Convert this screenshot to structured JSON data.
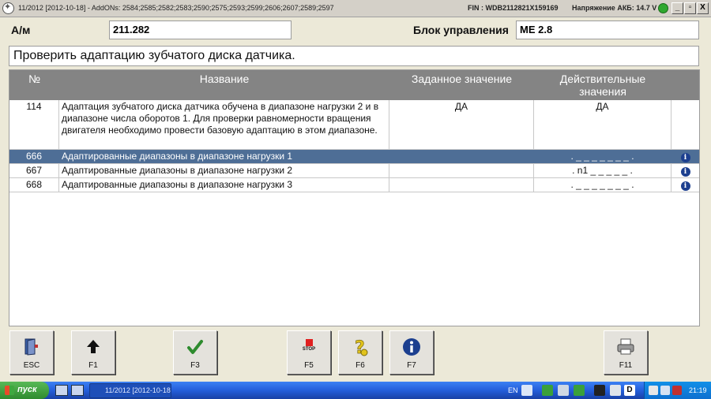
{
  "window": {
    "title": "11/2012 [2012-10-18] - AddONs: 2584;2585;2582;2583;2590;2575;2593;2599;2606;2607;2589;2597",
    "fin": "FIN : WDB2112821X159169",
    "battery": "Напряжение АКБ: 14.7 V",
    "controls": [
      "_",
      "▫",
      "X"
    ]
  },
  "header": {
    "vehicle_label": "А/м",
    "vehicle_value": "211.282",
    "ecu_label": "Блок управления",
    "ecu_value": "ME 2.8"
  },
  "instruction": "Проверить адаптацию зубчатого диска датчика.",
  "table": {
    "columns": [
      "№",
      "Название",
      "Заданное значение",
      "Действительные значения"
    ],
    "rows": [
      {
        "num": "114",
        "name": "Адаптация зубчатого диска датчика обучена в диапазоне нагрузки 2 и в диапазоне числа оборотов 1. Для проверки равномерности вращения двигателя необходимо провести базовую адаптацию в этом диапазоне.",
        "spec": "ДА",
        "actual": "ДА",
        "info": false,
        "selected": false
      },
      {
        "num": "666",
        "name": "Адаптированные диапазоны в диапазоне нагрузки 1",
        "spec": "",
        "actual": ". _ _ _ _ _ _ _ .",
        "info": true,
        "selected": true
      },
      {
        "num": "667",
        "name": "Адаптированные диапазоны в диапазоне нагрузки 2",
        "spec": "",
        "actual": ". n1 _ _ _ _ _ .",
        "info": true,
        "selected": false
      },
      {
        "num": "668",
        "name": "Адаптированные диапазоны в диапазоне нагрузки 3",
        "spec": "",
        "actual": ". _ _ _ _ _ _ _ .",
        "info": true,
        "selected": false
      }
    ]
  },
  "fkeys": [
    {
      "key": "ESC",
      "icon": "exit-door-icon"
    },
    {
      "key": "F1",
      "icon": "arrow-up-icon"
    },
    {
      "key": "F3",
      "icon": "check-icon"
    },
    {
      "key": "F5",
      "icon": "stop-icon",
      "icon_text": "STOP"
    },
    {
      "key": "F6",
      "icon": "help-icon"
    },
    {
      "key": "F7",
      "icon": "info-icon"
    },
    {
      "key": "F11",
      "icon": "printer-icon"
    }
  ],
  "taskbar": {
    "start_label": "пуск",
    "task_label": "11/2012 [2012-10-18...",
    "lang": "EN",
    "clock": "21:19",
    "tray_d": "D"
  },
  "colors": {
    "selected_row": "#4e6e96",
    "header_bg": "#848484",
    "battery_ok": "#2fa82f"
  }
}
